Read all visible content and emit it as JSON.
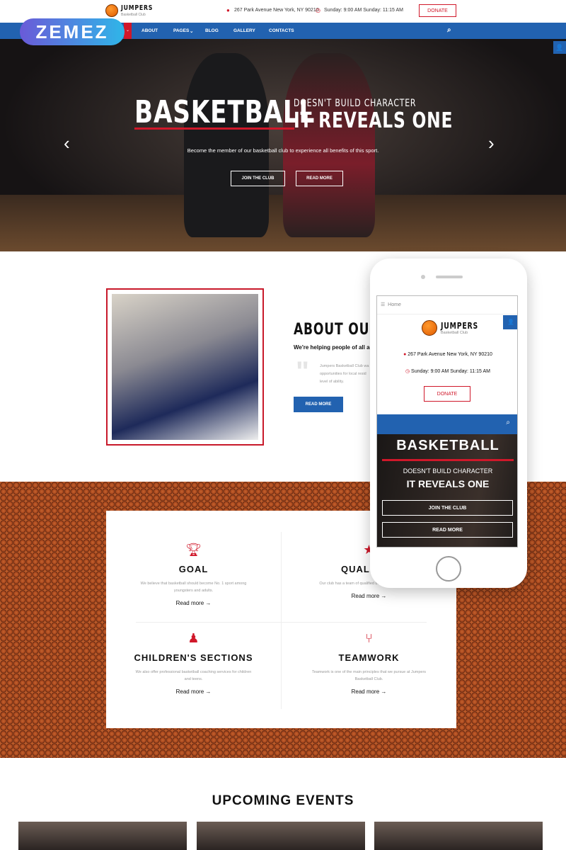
{
  "brand": {
    "name": "JUMPERS",
    "tagline": "Basketball Club",
    "watermark": "ZEMEZ"
  },
  "header": {
    "address": "267 Park Avenue New York, NY 90210",
    "hours": "Sunday: 9:00 AM Sunday: 11:15 AM",
    "donate": "DONATE"
  },
  "nav": {
    "items": [
      "ABOUT",
      "PAGES",
      "BLOG",
      "GALLERY",
      "CONTACTS"
    ]
  },
  "hero": {
    "title": "BASKETBALL",
    "line1": "DOESN'T BUILD CHARACTER",
    "line2": "IT REVEALS ONE",
    "text": "Become the member of our basketball club to experience all benefits of this sport.",
    "join": "JOIN THE CLUB",
    "more": "READ MORE"
  },
  "about": {
    "title": "ABOUT OUR C",
    "subtitle": "We're helping people of all ages",
    "quote": [
      "Jumpers Basketball Club wa",
      "opportunities for local resid",
      "level of ability."
    ],
    "button": "READ MORE"
  },
  "features": [
    {
      "icon": "trophy-icon",
      "title": "GOAL",
      "text": "We believe that basketball should become No. 1 sport among youngsters and adults.",
      "link": "Read more"
    },
    {
      "icon": "star-icon",
      "title": "QUALIFIED",
      "text": "Our club has a team of qualified b... care of your success.",
      "link": "Read more"
    },
    {
      "icon": "child-icon",
      "title": "CHILDREN'S SECTIONS",
      "text": "We also offer professional basketball coaching services for children and teens.",
      "link": "Read more"
    },
    {
      "icon": "git-branch-icon",
      "title": "TEAMWORK",
      "text": "Teamwork is one of the main principles that we pursue at Jumpers Basketball Club.",
      "link": "Read more"
    }
  ],
  "mobile": {
    "breadcrumb": "Home",
    "address": "267 Park Avenue New York, NY 90210",
    "hours": "Sunday: 9:00 AM Sunday: 11:15 AM",
    "donate": "DONATE",
    "title": "BASKETBALL",
    "line1": "DOESN'T BUILD CHARACTER",
    "line2": "IT REVEALS ONE",
    "join": "JOIN THE CLUB",
    "more": "READ MORE"
  },
  "events": {
    "title": "UPCOMING EVENTS"
  },
  "colors": {
    "accent": "#d0182a",
    "nav": "#2262b0"
  }
}
